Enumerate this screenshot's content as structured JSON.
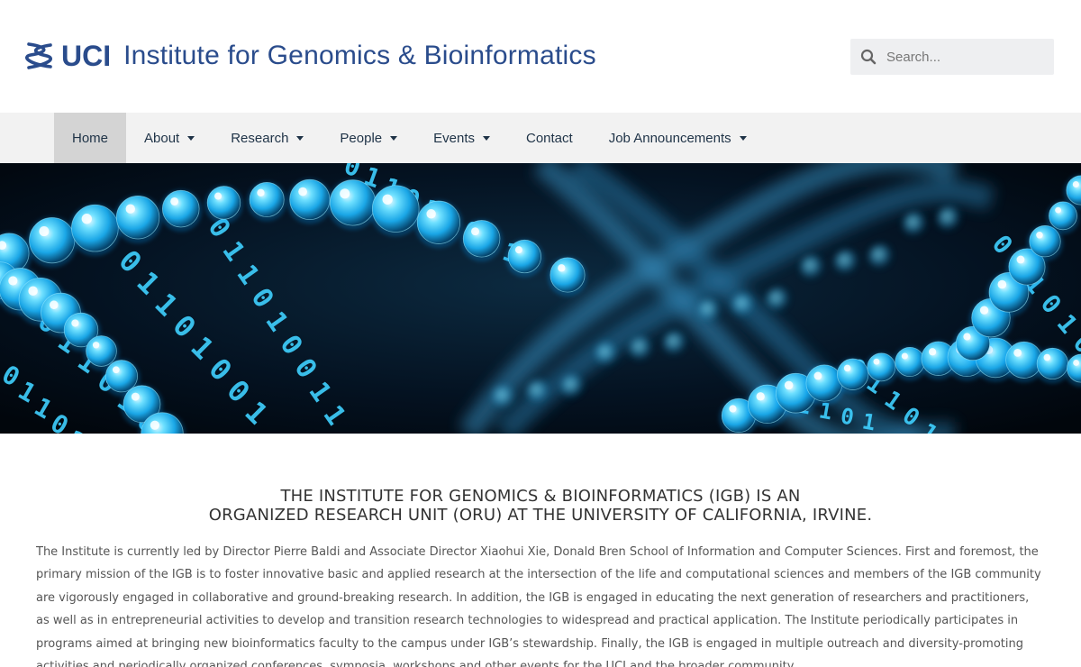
{
  "header": {
    "logo": {
      "mark_icon": "dna-helix-icon",
      "uci_text": "UCI",
      "institute_text": "Institute for Genomics & Bioinformatics",
      "brand_color": "#2a4c8c"
    },
    "search": {
      "icon": "search-icon",
      "placeholder": "Search..."
    }
  },
  "nav": {
    "items": [
      {
        "label": "Home",
        "active": true,
        "has_dropdown": false
      },
      {
        "label": "About",
        "active": false,
        "has_dropdown": true
      },
      {
        "label": "Research",
        "active": false,
        "has_dropdown": true
      },
      {
        "label": "People",
        "active": false,
        "has_dropdown": true
      },
      {
        "label": "Events",
        "active": false,
        "has_dropdown": true
      },
      {
        "label": "Contact",
        "active": false,
        "has_dropdown": false
      },
      {
        "label": "Job Announcements",
        "active": false,
        "has_dropdown": true
      }
    ],
    "text_color": "#1f3347",
    "bar_color": "#f2f2f2",
    "active_color": "#d4d4d4"
  },
  "hero": {
    "image": "dna-binary-helix-banner",
    "accent_color": "#19b8ff"
  },
  "main": {
    "headline_line1": "THE INSTITUTE FOR GENOMICS & BIOINFORMATICS (IGB) IS AN",
    "headline_line2": "ORGANIZED RESEARCH UNIT (ORU) AT THE UNIVERSITY OF CALIFORNIA, IRVINE.",
    "paragraph": "The Institute is currently led by Director Pierre Baldi and Associate Director Xiaohui Xie, Donald Bren School of Information and Computer Sciences. First and foremost, the primary mission of the IGB is to foster innovative basic and applied research at the intersection of the life and computational sciences and members of the IGB community are vigorously engaged in collaborative and ground-breaking research. In addition, the IGB is engaged in educating the next generation of researchers and practitioners, as well as in entrepreneurial activities to develop and transition research technologies to widespread and practical application. The Institute periodically participates in programs aimed at bringing new bioinformatics faculty to the campus under IGB’s stewardship. Finally, the IGB is engaged in multiple outreach and diversity-promoting activities and periodically organized conferences, symposia, workshops and other events for the UCI and the broader community."
  }
}
